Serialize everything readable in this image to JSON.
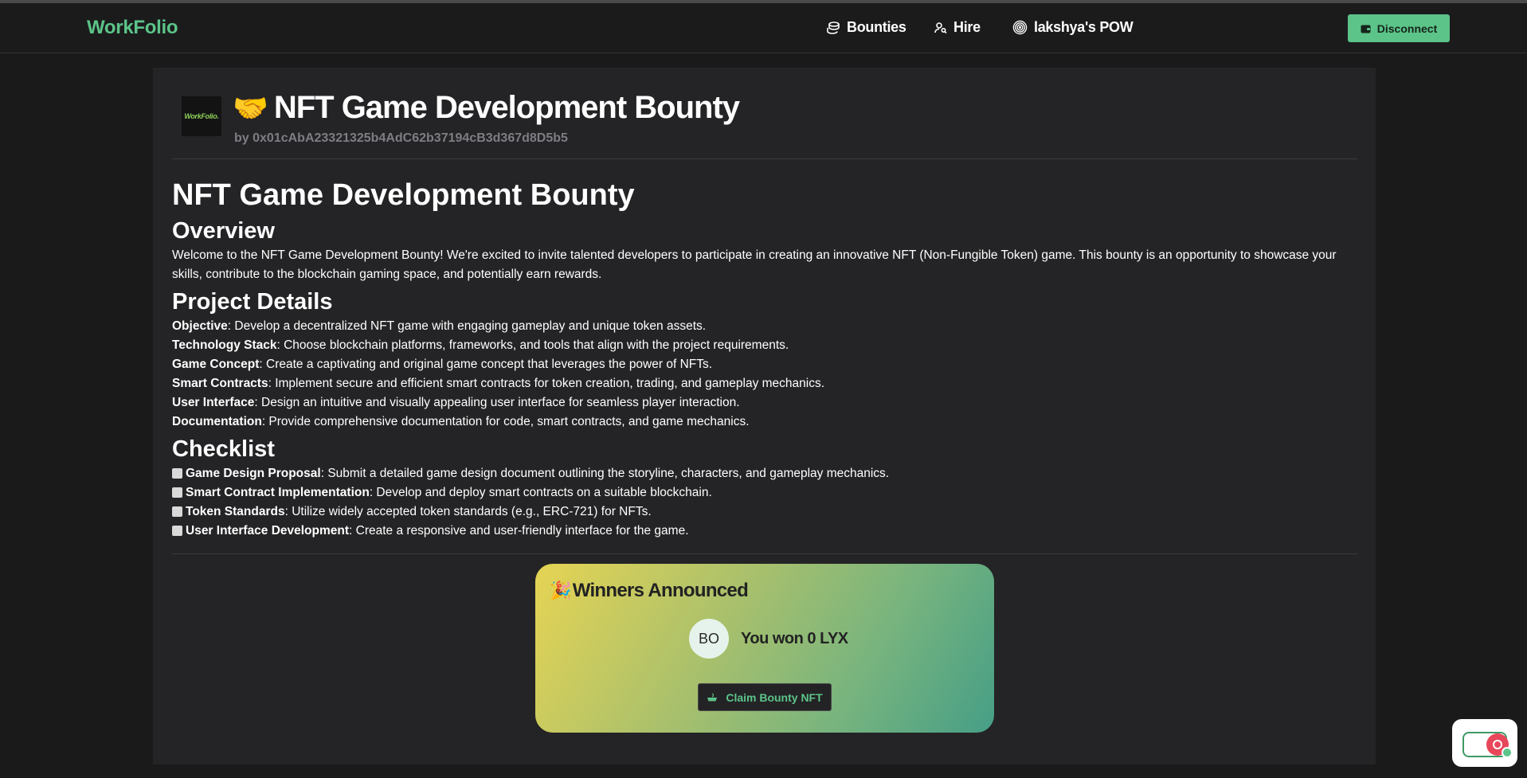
{
  "nav": {
    "logo": "WorkFolio",
    "links": [
      {
        "label": "Bounties",
        "icon": "coins-icon"
      },
      {
        "label": "Hire",
        "icon": "user-search-icon"
      },
      {
        "label": "lakshya's POW",
        "icon": "fingerprint-icon"
      }
    ],
    "disconnect_label": "Disconnect"
  },
  "bounty": {
    "logo_text": "WorkFolio.",
    "header_emoji": "🤝",
    "header_title": "NFT Game Development Bounty",
    "author": "by 0x01cAbA23321325b4AdC62b37194cB3d367d8D5b5",
    "title": "NFT Game Development Bounty",
    "overview_heading": "Overview",
    "overview_text": "Welcome to the NFT Game Development Bounty! We're excited to invite talented developers to participate in creating an innovative NFT (Non-Fungible Token) game. This bounty is an opportunity to showcase your skills, contribute to the blockchain gaming space, and potentially earn rewards.",
    "details_heading": "Project Details",
    "details": [
      {
        "term": "Objective",
        "text": ": Develop a decentralized NFT game with engaging gameplay and unique token assets."
      },
      {
        "term": "Technology Stack",
        "text": ": Choose blockchain platforms, frameworks, and tools that align with the project requirements."
      },
      {
        "term": "Game Concept",
        "text": ": Create a captivating and original game concept that leverages the power of NFTs."
      },
      {
        "term": "Smart Contracts",
        "text": ": Implement secure and efficient smart contracts for token creation, trading, and gameplay mechanics."
      },
      {
        "term": "User Interface",
        "text": ": Design an intuitive and visually appealing user interface for seamless player interaction."
      },
      {
        "term": "Documentation",
        "text": ": Provide comprehensive documentation for code, smart contracts, and game mechanics."
      }
    ],
    "checklist_heading": "Checklist",
    "checklist": [
      {
        "term": "Game Design Proposal",
        "text": ": Submit a detailed game design document outlining the storyline, characters, and gameplay mechanics."
      },
      {
        "term": "Smart Contract Implementation",
        "text": ": Develop and deploy smart contracts on a suitable blockchain."
      },
      {
        "term": "Token Standards",
        "text": ": Utilize widely accepted token standards (e.g., ERC-721) for NFTs."
      },
      {
        "term": "User Interface Development",
        "text": ": Create a responsive and user-friendly interface for the game."
      }
    ]
  },
  "winners": {
    "emoji": "🎉",
    "title": "Winners Announced",
    "avatar_initials": "BO",
    "result_text": "You won 0 LYX",
    "claim_label": "Claim Bounty NFT"
  },
  "colors": {
    "accent": "#5cc489",
    "background": "#1a1a1b",
    "card": "#242426"
  }
}
